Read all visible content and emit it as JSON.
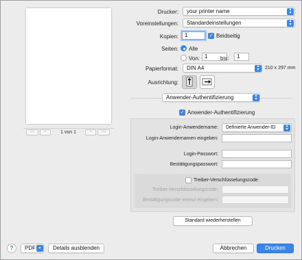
{
  "preview": {
    "page_label": "1 von 1",
    "first_icon": "<<",
    "prev_icon": "<",
    "next_icon": ">",
    "last_icon": ">>"
  },
  "printer": {
    "label": "Drucker:",
    "value": "your printer name"
  },
  "presets": {
    "label": "Voreinstellungen:",
    "value": "Standardeinstellungen"
  },
  "copies": {
    "label": "Kopien:",
    "value": "1",
    "duplex_label": "Beidseitig",
    "duplex_checked": true
  },
  "pages": {
    "label": "Seiten:",
    "all_label": "Alle",
    "from_label": "Von:",
    "from_value": "1",
    "to_label": "bis:",
    "to_value": "1"
  },
  "paper": {
    "label": "Papierformat:",
    "value": "DIN A4",
    "size_text": "210 x 297 mm"
  },
  "orientation": {
    "label": "Ausrichtung:"
  },
  "section_popup": {
    "value": "Anwender-Authentifizierung"
  },
  "auth": {
    "checkbox_label": "Anwender-Authentifizierung",
    "login_name_label": "Login-Anwendername:",
    "login_name_value": "Definierte Anwender-ID",
    "enter_name_label": "Login-Anwendernamen eingeben:",
    "password_label": "Login-Passwort:",
    "confirm_password_label": "Bestätigungspasswort:",
    "driver_encryption_label": "Treiber-Verschlüsselungscode",
    "driver_code_label": "Treiber-Verschlüsselungscode:",
    "driver_code_confirm_label": "Bestätigungscode erneut eingeben:"
  },
  "restore_label": "Standard wiederherstellen",
  "footer": {
    "help": "?",
    "pdf_label": "PDF",
    "hide_details": "Details ausblenden",
    "cancel": "Abbrechen",
    "print": "Drucken"
  },
  "colors": {
    "accent": "#3a85e6"
  },
  "icons": [
    "help-icon",
    "pdf-menu-chevron-icon",
    "popup-stepper-icon",
    "checkmark-icon",
    "portrait-orientation-icon",
    "landscape-orientation-icon"
  ]
}
